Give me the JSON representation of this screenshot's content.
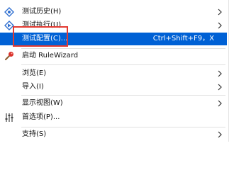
{
  "menu": {
    "items": [
      {
        "label": "测试历史(H)",
        "icon": "test-history-icon"
      },
      {
        "label": "测试执行(U)",
        "icon": "test-run-icon"
      },
      {
        "label": "测试配置(C)...",
        "shortcut": "Ctrl+Shift+F9，X",
        "selected": true
      },
      {
        "label": "启动 RuleWizard",
        "icon": "rulewizard-icon"
      },
      {
        "label": "浏览(E)"
      },
      {
        "label": "导入(I)"
      },
      {
        "label": "显示视图(W)"
      },
      {
        "label": "首选项(P)...",
        "icon": "preferences-icon"
      },
      {
        "label": "支持(S)"
      }
    ]
  },
  "colors": {
    "selection": "#0061d5",
    "highlight_box": "#e33a31"
  }
}
